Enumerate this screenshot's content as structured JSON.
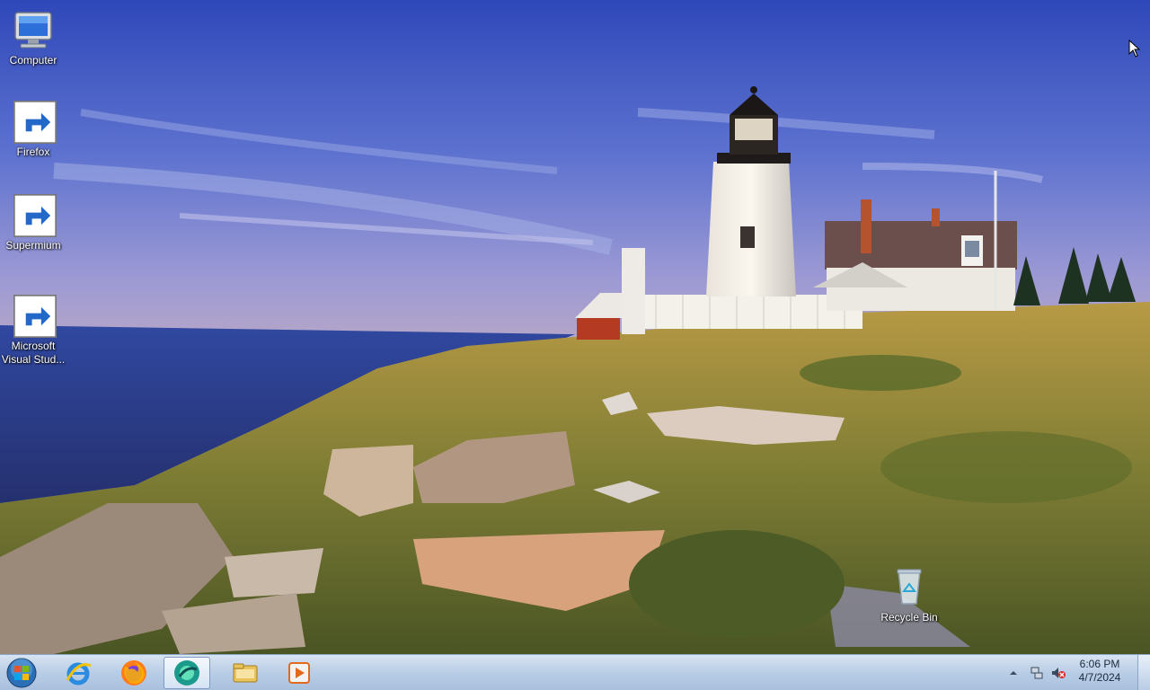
{
  "desktop": {
    "icons": [
      {
        "label": "Computer",
        "icon": "computer-icon"
      },
      {
        "label": "Firefox",
        "icon": "firefox-icon"
      },
      {
        "label": "Supermium",
        "icon": "supermium-icon"
      },
      {
        "label": "Microsoft\nVisual Stud...",
        "icon": "visual-studio-icon"
      },
      {
        "label": "Recycle Bin",
        "icon": "recycle-bin-icon"
      }
    ]
  },
  "taskbar": {
    "start": {
      "icon": "windows-orb-icon"
    },
    "pinned": [
      {
        "icon": "internet-explorer-icon"
      },
      {
        "icon": "firefox-icon"
      },
      {
        "icon": "supermium-icon",
        "active": true
      },
      {
        "icon": "file-explorer-icon"
      },
      {
        "icon": "media-player-icon"
      }
    ],
    "tray": {
      "icons": [
        "show-hidden-icons-arrow",
        "network-icon",
        "volume-muted-icon"
      ],
      "time": "6:06 PM",
      "date": "4/7/2024"
    }
  },
  "colors": {
    "taskbar": "#b9cde6",
    "sky": "#3d5fc8"
  }
}
